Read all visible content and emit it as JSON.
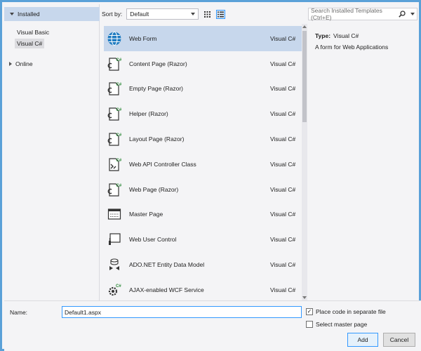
{
  "sidebar": {
    "installed_label": "Installed",
    "items": [
      {
        "label": "Visual Basic"
      },
      {
        "label": "Visual C#"
      }
    ],
    "online_label": "Online"
  },
  "toolbar": {
    "sort_label": "Sort by:",
    "sort_value": "Default"
  },
  "search": {
    "placeholder": "Search Installed Templates (Ctrl+E)"
  },
  "templates": [
    {
      "name": "Web Form",
      "lang": "Visual C#",
      "icon": "globe-icon"
    },
    {
      "name": "Content Page (Razor)",
      "lang": "Visual C#",
      "icon": "razor-page-icon"
    },
    {
      "name": "Empty Page (Razor)",
      "lang": "Visual C#",
      "icon": "razor-page-icon"
    },
    {
      "name": "Helper (Razor)",
      "lang": "Visual C#",
      "icon": "razor-page-icon"
    },
    {
      "name": "Layout Page (Razor)",
      "lang": "Visual C#",
      "icon": "razor-page-icon"
    },
    {
      "name": "Web API Controller Class",
      "lang": "Visual C#",
      "icon": "api-controller-icon"
    },
    {
      "name": "Web Page (Razor)",
      "lang": "Visual C#",
      "icon": "razor-page-icon"
    },
    {
      "name": "Master Page",
      "lang": "Visual C#",
      "icon": "master-page-icon"
    },
    {
      "name": "Web User Control",
      "lang": "Visual C#",
      "icon": "user-control-icon"
    },
    {
      "name": "ADO.NET Entity Data Model",
      "lang": "Visual C#",
      "icon": "entity-model-icon"
    },
    {
      "name": "AJAX-enabled WCF Service",
      "lang": "Visual C#",
      "icon": "wcf-service-icon"
    }
  ],
  "details": {
    "type_label": "Type:",
    "type_value": "Visual C#",
    "description": "A form for Web Applications"
  },
  "bottom": {
    "name_label": "Name:",
    "name_value": "Default1.aspx",
    "place_code_label": "Place code in separate file",
    "place_code_checked": true,
    "master_label": "Select master page",
    "master_checked": false,
    "add_label": "Add",
    "cancel_label": "Cancel"
  },
  "colors": {
    "frame_border": "#5aa1d8",
    "selection": "#c7d7ec",
    "accent": "#3399ff"
  }
}
